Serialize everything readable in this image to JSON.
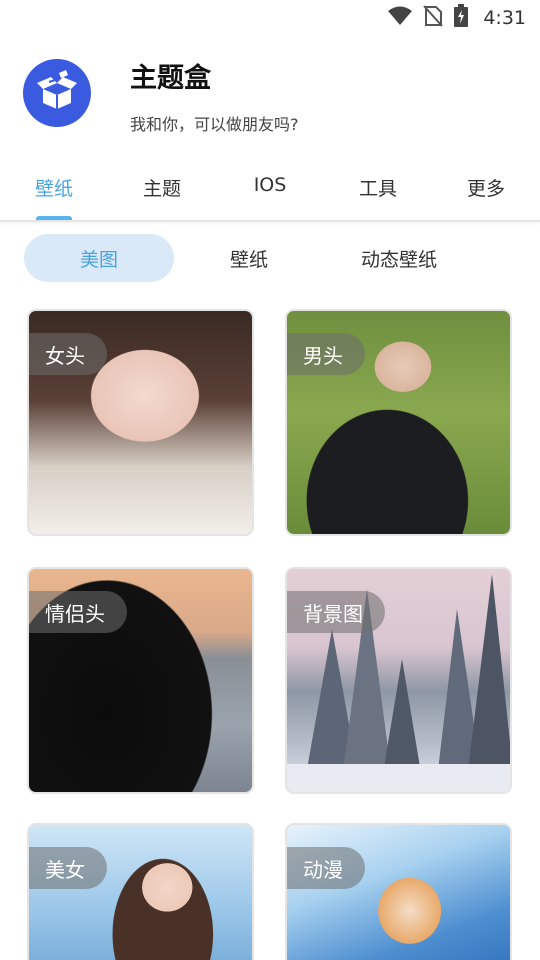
{
  "status_bar": {
    "time": "4:31",
    "icons": [
      "wifi-icon",
      "no-sim-icon",
      "battery-charging-icon"
    ]
  },
  "header": {
    "logo_icon": "open-box-icon",
    "title": "主题盒",
    "subtitle": "我和你，可以做朋友吗?",
    "accent_color": "#3a5be0"
  },
  "main_tabs": [
    {
      "label": "壁纸",
      "active": true
    },
    {
      "label": "主题",
      "active": false
    },
    {
      "label": "IOS",
      "active": false
    },
    {
      "label": "工具",
      "active": false
    },
    {
      "label": "更多",
      "active": false
    }
  ],
  "sub_tabs": [
    {
      "label": "美图",
      "active": true
    },
    {
      "label": "壁纸",
      "active": false
    },
    {
      "label": "动态壁纸",
      "active": false
    }
  ],
  "cards": [
    {
      "label": "女头"
    },
    {
      "label": "男头"
    },
    {
      "label": "情侣头"
    },
    {
      "label": "背景图"
    },
    {
      "label": "美女"
    },
    {
      "label": "动漫"
    }
  ],
  "colors": {
    "active_tab": "#4aa3df",
    "sub_tab_active_bg": "#d9e9f7"
  }
}
